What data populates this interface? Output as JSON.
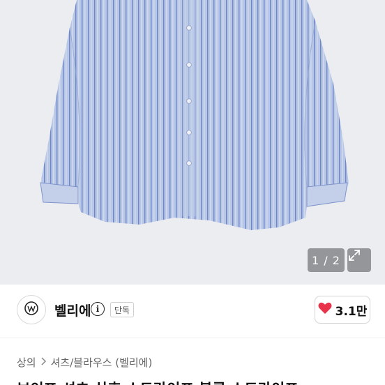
{
  "gallery": {
    "counter": "1 / 2",
    "colors": {
      "background": "#ecedf0",
      "shirt": "#b8c7e6",
      "stripe": "#6e86c7"
    }
  },
  "seller": {
    "name": "벨리에",
    "badge": "단독",
    "like_count": "3.1만",
    "heart_color": "#e8334a"
  },
  "breadcrumb": {
    "items": [
      "상의",
      "셔츠/블라우스 (벨리에)"
    ]
  },
  "product": {
    "title": "보이프 셔츠 상후 스트라이프 블루 스트라이프"
  },
  "icons": [
    "expand-icon",
    "info-icon",
    "heart-icon",
    "chevron-right-icon",
    "brand-logo"
  ]
}
